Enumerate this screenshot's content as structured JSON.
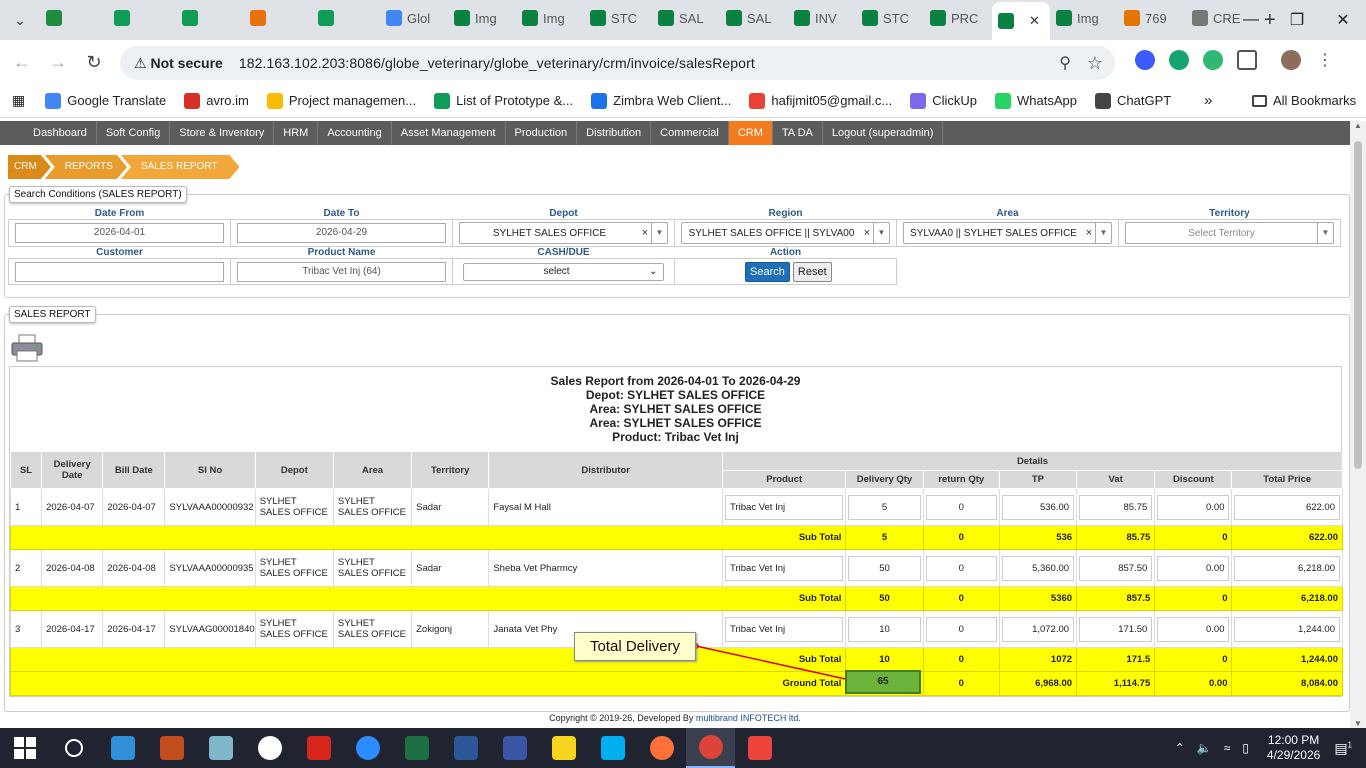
{
  "browser": {
    "tabs": [
      {
        "label": "",
        "color": "#1e8e3e"
      },
      {
        "label": "",
        "color": "#0f9d58"
      },
      {
        "label": "",
        "color": "#0f9d58"
      },
      {
        "label": "",
        "color": "#e8710a"
      },
      {
        "label": "",
        "color": "#0f9d58"
      },
      {
        "label": "Glol",
        "color": "#4285f4"
      },
      {
        "label": "Img",
        "color": "#0b8043"
      },
      {
        "label": "Img",
        "color": "#0b8043"
      },
      {
        "label": "STC",
        "color": "#0b8043"
      },
      {
        "label": "SAL",
        "color": "#0b8043"
      },
      {
        "label": "SAL",
        "color": "#0b8043"
      },
      {
        "label": "INV",
        "color": "#0b8043"
      },
      {
        "label": "STC",
        "color": "#0b8043"
      },
      {
        "label": "PRC",
        "color": "#0b8043"
      },
      {
        "label": "",
        "color": "#0b8043",
        "active": true
      },
      {
        "label": "Img",
        "color": "#0b8043"
      },
      {
        "label": "769",
        "color": "#e37400"
      },
      {
        "label": "CRE",
        "color": "#777777"
      }
    ],
    "security": "Not secure",
    "url": "182.163.102.203:8086/globe_veterinary/globe_veterinary/crm/invoice/salesReport",
    "bookmarks": [
      {
        "label": "Google Translate",
        "color": "#4285f4"
      },
      {
        "label": "avro.im",
        "color": "#d93025"
      },
      {
        "label": "Project managemen...",
        "color": "#fbbc04"
      },
      {
        "label": "List of Prototype &...",
        "color": "#0f9d58"
      },
      {
        "label": "Zimbra Web Client...",
        "color": "#1a73e8"
      },
      {
        "label": "hafijmit05@gmail.c...",
        "color": "#ea4335"
      },
      {
        "label": "ClickUp",
        "color": "#7b68ee"
      },
      {
        "label": "WhatsApp",
        "color": "#25d366"
      },
      {
        "label": "ChatGPT",
        "color": "#444444"
      }
    ],
    "all_bookmarks": "All Bookmarks"
  },
  "nav": [
    "Dashboard",
    "Soft Config",
    "Store & Inventory",
    "HRM",
    "Accounting",
    "Asset Management",
    "Production",
    "Distribution",
    "Commercial",
    "CRM",
    "TA DA",
    "Logout (superadmin)"
  ],
  "nav_active": "CRM",
  "breadcrumb": [
    "CRM",
    "REPORTS",
    "SALES REPORT"
  ],
  "search": {
    "legend": "Search Conditions (SALES REPORT)",
    "labels": {
      "date_from": "Date From",
      "date_to": "Date To",
      "depot": "Depot",
      "region": "Region",
      "area": "Area",
      "territory": "Territory",
      "customer": "Customer",
      "product": "Product Name",
      "cash": "CASH/DUE",
      "action": "Action"
    },
    "date_from": "2026-04-01",
    "date_to": "2026-04-29",
    "depot": "SYLHET SALES OFFICE",
    "region": "SYLHET SALES OFFICE || SYLVA00",
    "area": "SYLVAA0 || SYLHET SALES OFFICE",
    "territory_placeholder": "Select Territory",
    "customer": "",
    "product": "Tribac Vet Inj (64)",
    "cash": "select",
    "search_btn": "Search",
    "reset_btn": "Reset"
  },
  "report": {
    "legend": "SALES REPORT",
    "title_lines": [
      "Sales Report from 2026-04-01 To 2026-04-29",
      "Depot: SYLHET SALES OFFICE",
      "Area: SYLHET SALES OFFICE",
      "Area: SYLHET SALES OFFICE",
      "Product: Tribac Vet Inj"
    ],
    "headers": {
      "sl": "SL",
      "delivery_date": "Delivery Date",
      "bill_date": "Bill Date",
      "si_no": "SI No",
      "depot": "Depot",
      "area": "Area",
      "territory": "Territory",
      "distributor": "Distributor",
      "details": "Details",
      "product": "Product",
      "delivery_qty": "Delivery Qty",
      "return_qty": "return Qty",
      "tp": "TP",
      "vat": "Vat",
      "discount": "Discount",
      "total_price": "Total Price"
    },
    "rows": [
      {
        "sl": "1",
        "delivery_date": "2026-04-07",
        "bill_date": "2026-04-07",
        "si_no": "SYLVAAA00000932",
        "depot": "SYLHET SALES OFFICE",
        "area": "SYLHET SALES OFFICE",
        "territory": "Sadar",
        "distributor": "Faysal M Hall",
        "product": "Tribac Vet Inj",
        "delivery_qty": "5",
        "return_qty": "0",
        "tp": "536.00",
        "vat": "85.75",
        "discount": "0.00",
        "total": "622.00",
        "sub": {
          "label": "Sub Total",
          "qty": "5",
          "ret": "0",
          "tp": "536",
          "vat": "85.75",
          "disc": "0",
          "total": "622.00"
        }
      },
      {
        "sl": "2",
        "delivery_date": "2026-04-08",
        "bill_date": "2026-04-08",
        "si_no": "SYLVAAA00000935",
        "depot": "SYLHET SALES OFFICE",
        "area": "SYLHET SALES OFFICE",
        "territory": "Sadar",
        "distributor": "Sheba Vet Pharmcy",
        "product": "Tribac Vet Inj",
        "delivery_qty": "50",
        "return_qty": "0",
        "tp": "5,360.00",
        "vat": "857.50",
        "discount": "0.00",
        "total": "6,218.00",
        "sub": {
          "label": "Sub Total",
          "qty": "50",
          "ret": "0",
          "tp": "5360",
          "vat": "857.5",
          "disc": "0",
          "total": "6,218.00"
        }
      },
      {
        "sl": "3",
        "delivery_date": "2026-04-17",
        "bill_date": "2026-04-17",
        "si_no": "SYLVAAG00001840",
        "depot": "SYLHET SALES OFFICE",
        "area": "SYLHET SALES OFFICE",
        "territory": "Zokigonj",
        "distributor": "Janata Vet Phy",
        "product": "Tribac Vet Inj",
        "delivery_qty": "10",
        "return_qty": "0",
        "tp": "1,072.00",
        "vat": "171.50",
        "discount": "0.00",
        "total": "1,244.00",
        "sub": {
          "label": "Sub Total",
          "qty": "10",
          "ret": "0",
          "tp": "1072",
          "vat": "171.5",
          "disc": "0",
          "total": "1,244.00"
        }
      }
    ],
    "ground_total": {
      "label": "Ground Total",
      "qty": "65",
      "ret": "0",
      "tp": "6,968.00",
      "vat": "1,114.75",
      "disc": "0.00",
      "total": "8,084.00"
    }
  },
  "annotation": {
    "text": "Total Delivery",
    "color": "#ff0000"
  },
  "footer": {
    "prefix": "Copyright © 2019-26, Developed By ",
    "link": "multibrand INFOTECH ltd."
  },
  "taskbar": {
    "time": "12:00 PM",
    "date": "4/29/2026",
    "notifications": "1"
  },
  "colors": {
    "nav_active": "#f47a1f",
    "subtotal_bg": "#ffff00",
    "search_btn": "#1f6fb8"
  }
}
